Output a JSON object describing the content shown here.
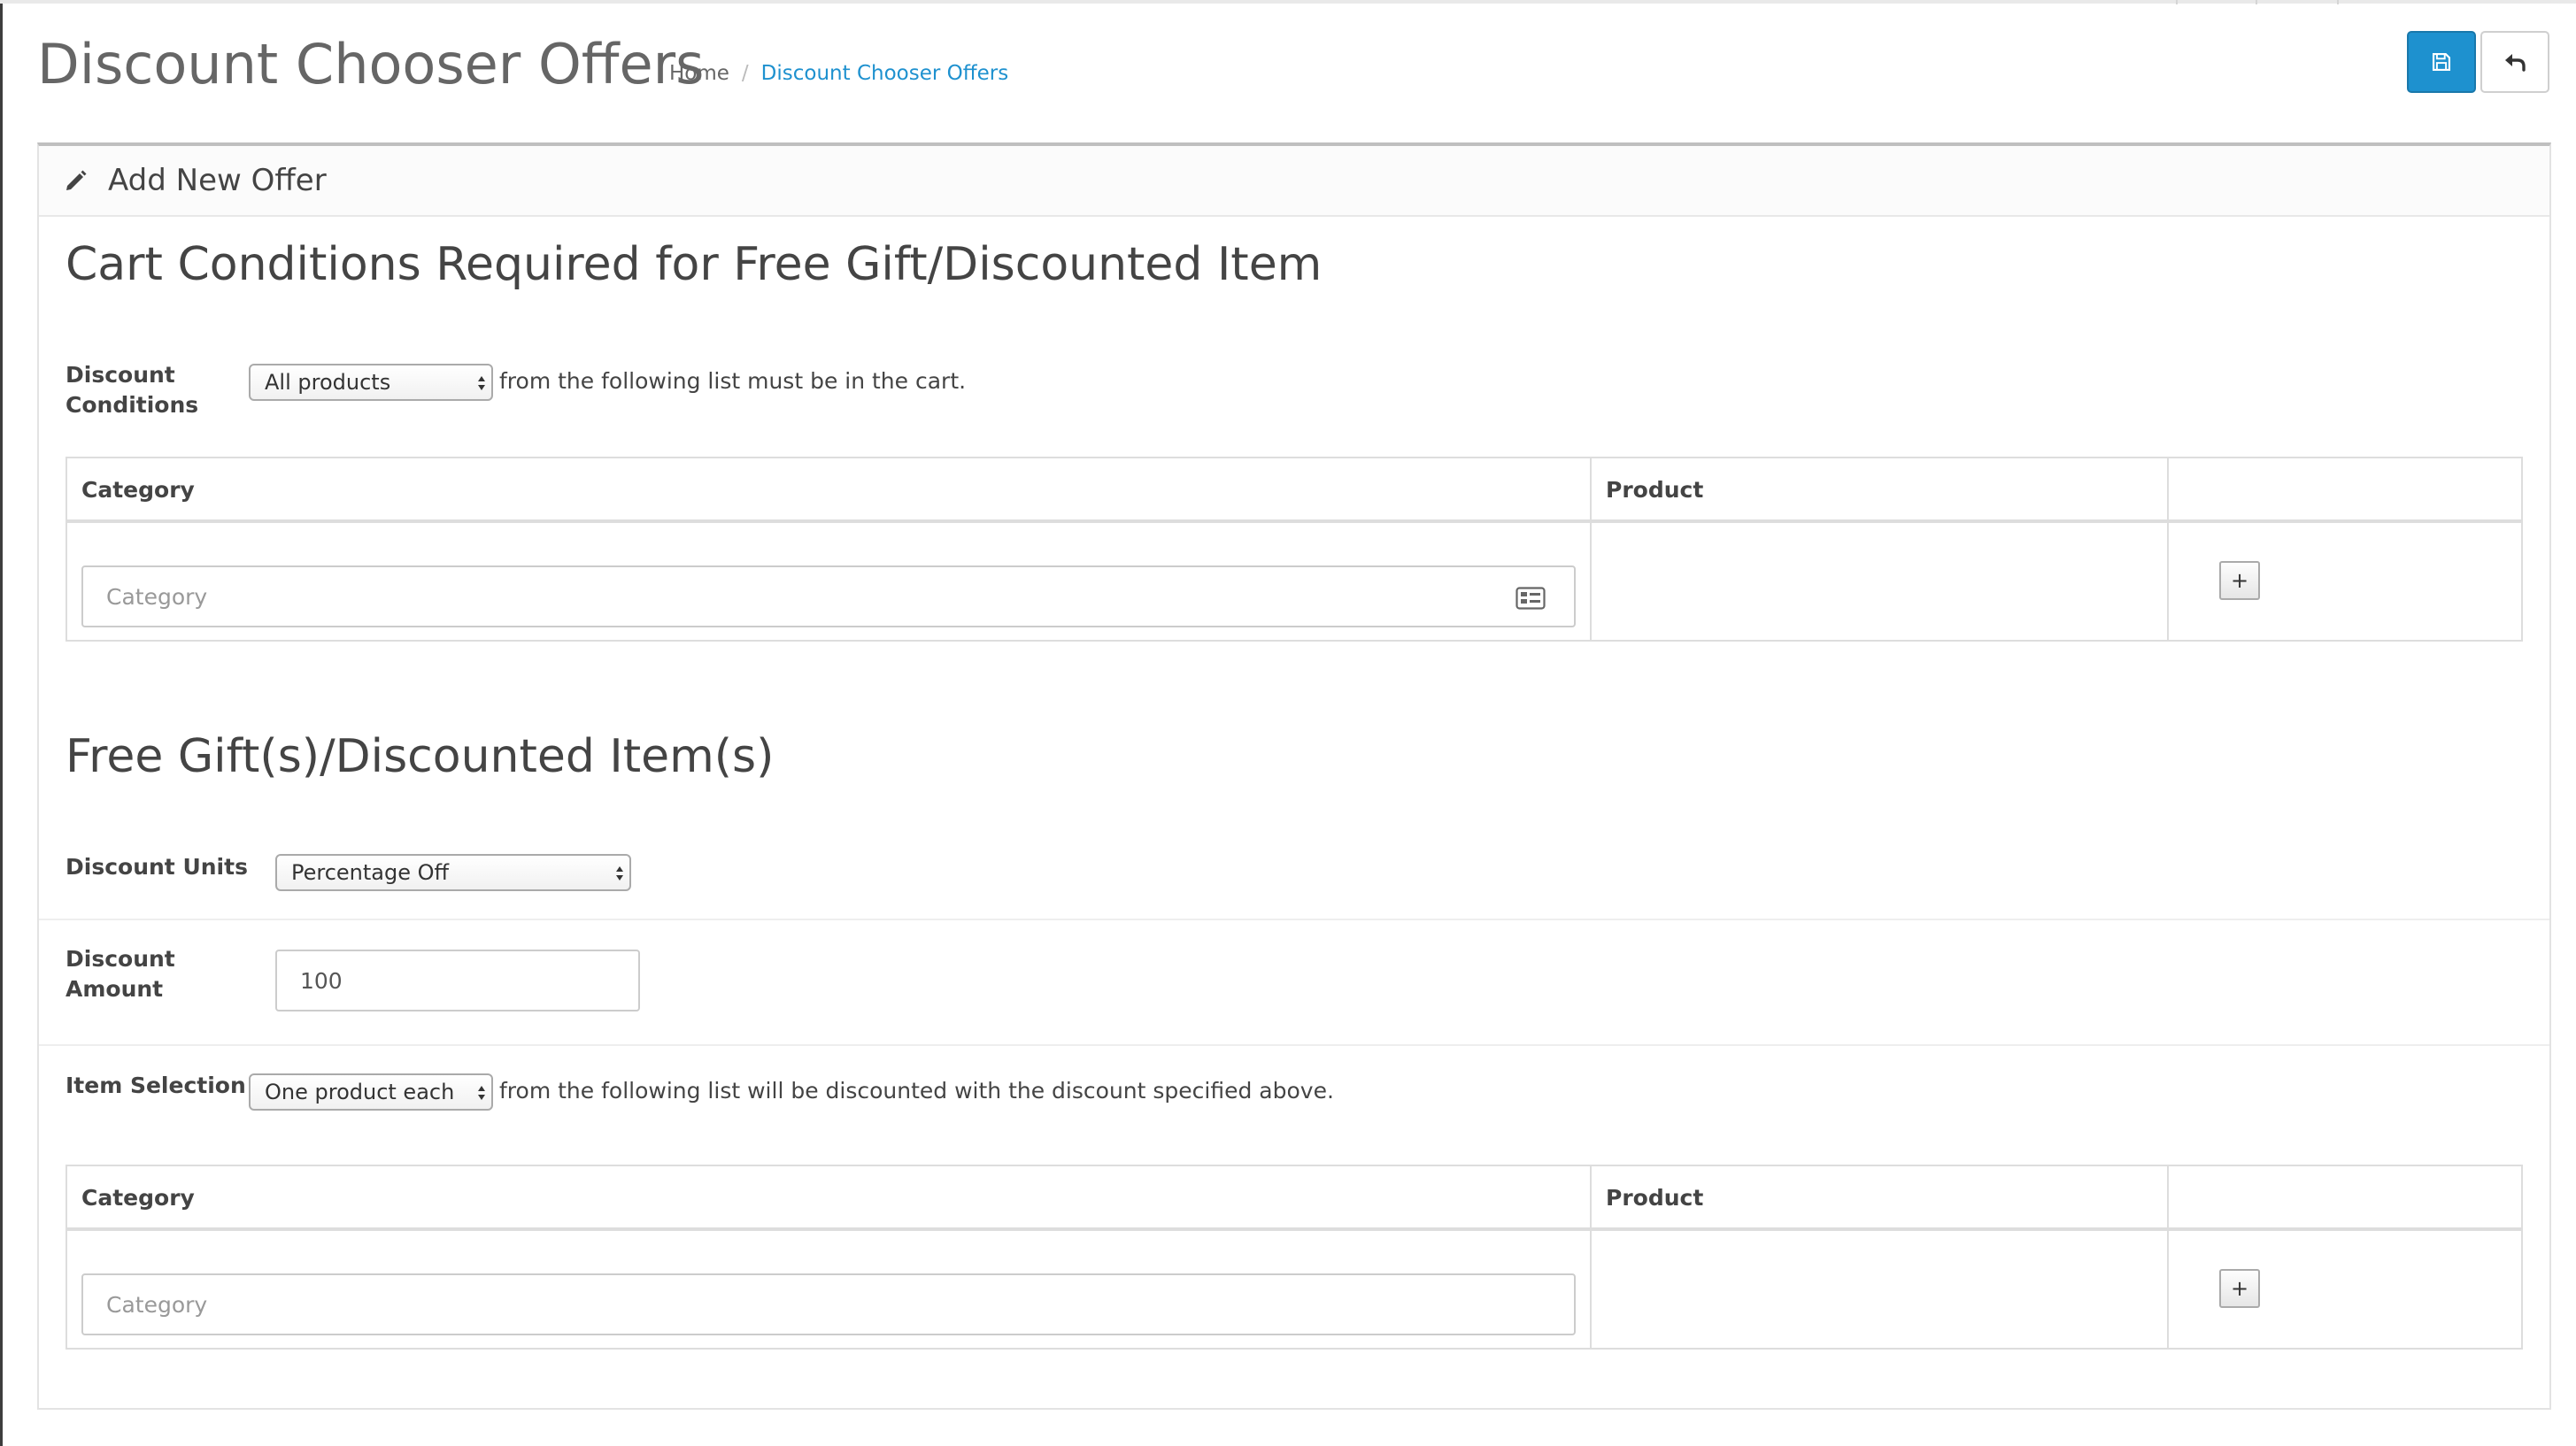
{
  "header": {
    "title": "Discount Chooser Offers",
    "breadcrumb": [
      {
        "label": "Home"
      },
      {
        "separator": "/"
      },
      {
        "label": "Discount Chooser Offers"
      }
    ],
    "save_button_icon": "save-icon",
    "back_button_icon": "reply-icon"
  },
  "panel": {
    "heading_icon": "pencil-icon",
    "heading": "Add New Offer"
  },
  "conditions": {
    "title": "Cart Conditions Required for Free Gift/Discounted Item",
    "label_line1": "Discount",
    "label_line2": "Conditions",
    "select_value": "All products",
    "suffix_text": "from the following list must be in the cart.",
    "table": {
      "columns": [
        "Category",
        "Product",
        ""
      ],
      "rows": [
        {
          "category_placeholder": "Category",
          "category_icon": "list-icon",
          "product": "",
          "add_label": "+"
        }
      ]
    }
  },
  "gifts": {
    "title": "Free Gift(s)/Discounted Item(s)",
    "units_label": "Discount Units",
    "units_value": "Percentage Off",
    "amount_label_line1": "Discount",
    "amount_label_line2": "Amount",
    "amount_value": "100",
    "selection_label": "Item Selection",
    "selection_value": "One product each",
    "selection_suffix": "from the following list will be discounted with the discount specified above.",
    "table": {
      "columns": [
        "Category",
        "Product",
        ""
      ],
      "rows": [
        {
          "category_placeholder": "Category",
          "product": "",
          "add_label": "+"
        }
      ]
    }
  },
  "colors": {
    "primary": "#1e91cf",
    "title_gray": "#666666",
    "border": "#dddddd"
  }
}
